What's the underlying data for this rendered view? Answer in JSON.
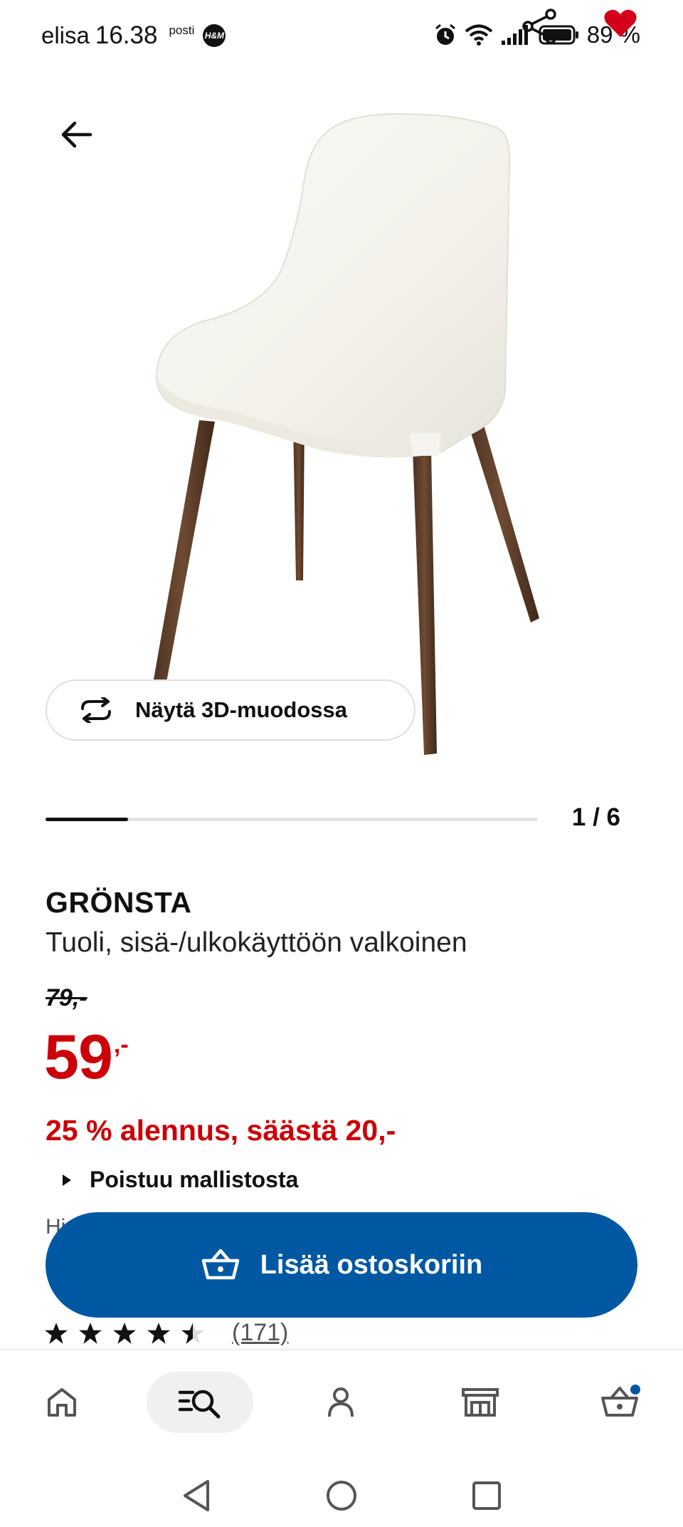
{
  "status_bar": {
    "carrier": "elisa",
    "time": "16.38",
    "app_badge_text": "posti",
    "hm_badge": "H&M",
    "battery": "89 %",
    "icons": [
      "alarm-icon",
      "wifi-icon",
      "signal-icon",
      "battery-icon",
      "share-icon",
      "heart-icon"
    ]
  },
  "hero": {
    "back_icon": "arrow-left-icon",
    "view_3d_label": "Näytä 3D-muodossa",
    "view_3d_icon": "rotate-icon"
  },
  "gallery": {
    "current": 1,
    "total": 6,
    "counter_text": "1 / 6",
    "progress_fraction": 0.167
  },
  "product": {
    "name": "GRÖNSTA",
    "description": "Tuoli, sisä-/ulkokäyttöön valkoinen",
    "old_price": "79,-",
    "price_amount": "59",
    "price_suffix": ",-",
    "discount_text": "25 % alennus, säästä 20,-",
    "discontinued_label": "Poistuu mallistosta",
    "partial_text": "Hi"
  },
  "cart_button": {
    "label": "Lisää ostoskoriin",
    "icon": "basket-icon"
  },
  "rating": {
    "stars": 4.5,
    "max_stars": 5,
    "review_count": "(171)"
  },
  "bottom_nav": {
    "items": [
      {
        "icon": "home-icon",
        "active": false
      },
      {
        "icon": "search-list-icon",
        "active": true
      },
      {
        "icon": "profile-icon",
        "active": false
      },
      {
        "icon": "store-icon",
        "active": false
      },
      {
        "icon": "cart-icon",
        "active": false,
        "badge": true
      }
    ]
  },
  "colors": {
    "price_red": "#cc0008",
    "ikea_blue": "#0058a3",
    "text": "#111111"
  }
}
